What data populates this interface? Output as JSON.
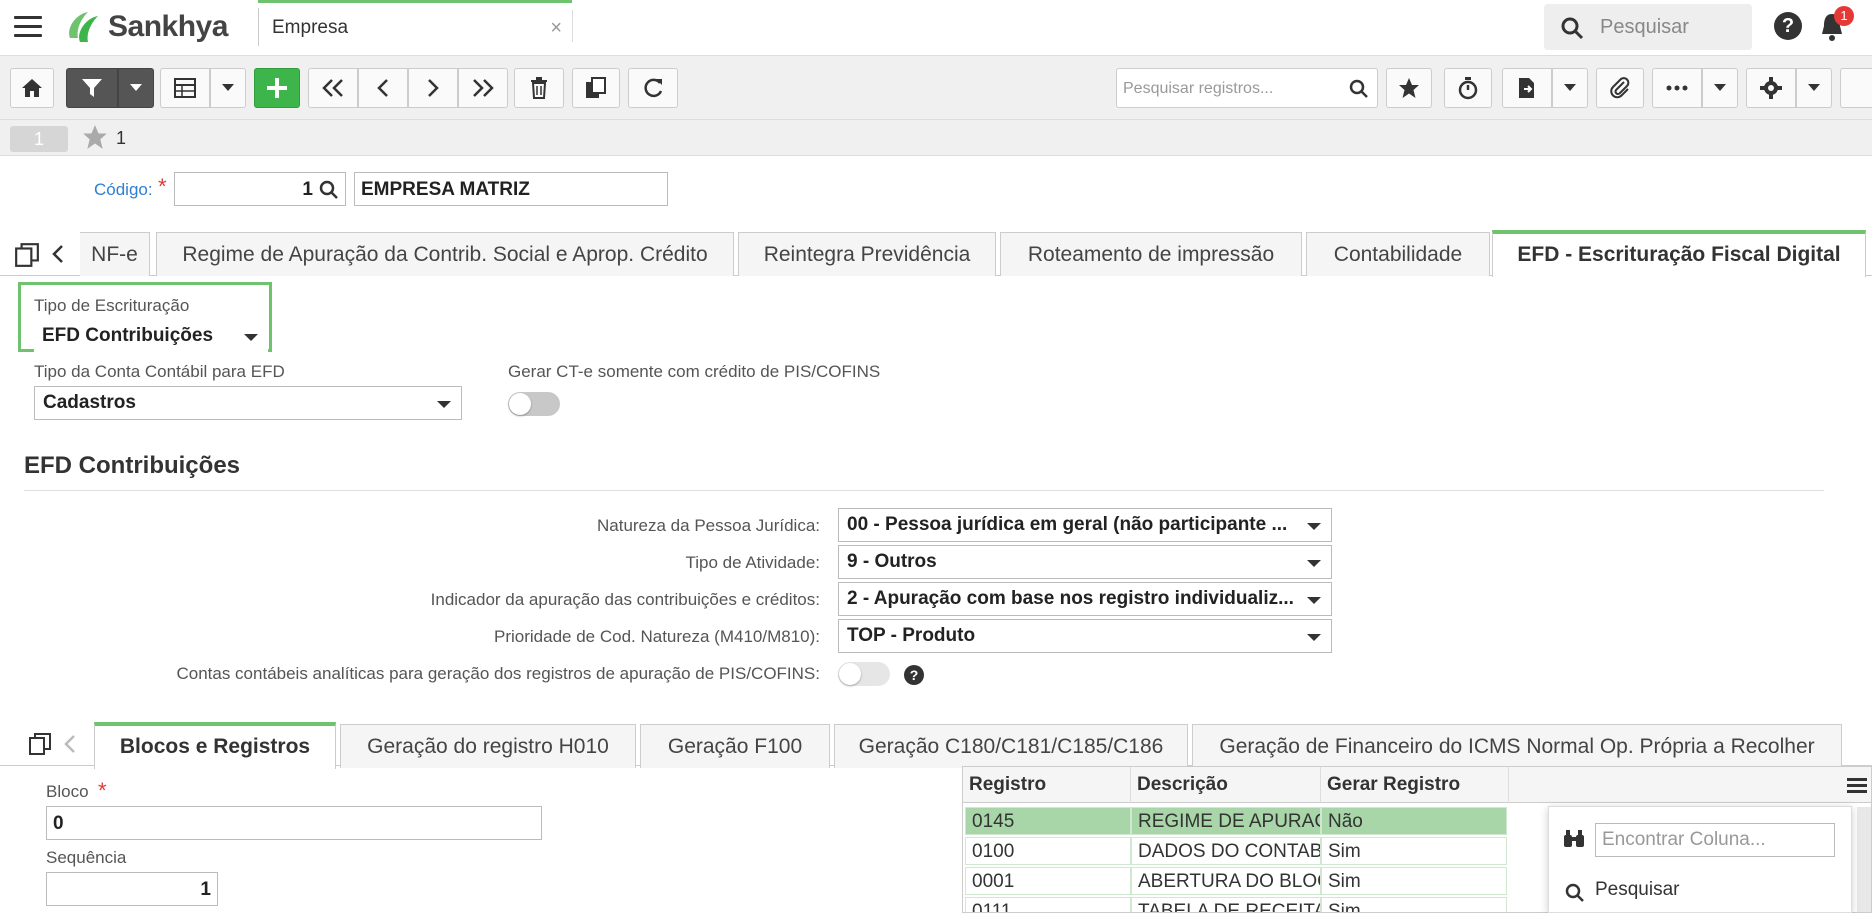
{
  "header": {
    "brand": "Sankhya",
    "app_tab_title": "Empresa",
    "close_glyph": "×",
    "search_placeholder": "Pesquisar",
    "help_glyph": "?",
    "notification_count": "1"
  },
  "toolbar": {
    "record_search_placeholder": "Pesquisar registros..."
  },
  "record_nav": {
    "page_pill": "1",
    "favorite_count": "1"
  },
  "codigo": {
    "label": "Código:",
    "required_mark": "*",
    "value": "1",
    "description": "EMPRESA MATRIZ"
  },
  "tabs": [
    {
      "label": "NF-e"
    },
    {
      "label": "Regime de Apuração da Contrib. Social e Aprop. Crédito"
    },
    {
      "label": "Reintegra Previdência"
    },
    {
      "label": "Roteamento de impressão"
    },
    {
      "label": "Contabilidade"
    },
    {
      "label": "EFD - Escrituração Fiscal Digital",
      "active": true
    }
  ],
  "efd": {
    "tipo_escrituracao_label": "Tipo de Escrituração",
    "tipo_escrituracao_value": "EFD Contribuições",
    "tipo_conta_label": "Tipo da Conta Contábil para EFD",
    "tipo_conta_value": "Cadastros",
    "gerar_cte_label": "Gerar CT-e somente com crédito de PIS/COFINS",
    "section_title": "EFD Contribuições",
    "natureza_label": "Natureza da Pessoa Jurídica:",
    "natureza_value": "00 - Pessoa jurídica em geral (não participante ...",
    "atividade_label": "Tipo de Atividade:",
    "atividade_value": "9 - Outros",
    "indicador_label": "Indicador da apuração das contribuições e créditos:",
    "indicador_value": "2 - Apuração com base nos registro individualiz...",
    "prioridade_label": "Prioridade de Cod. Natureza (M410/M810):",
    "prioridade_value": "TOP - Produto",
    "contas_label": "Contas contábeis analíticas para geração dos registros de apuração de PIS/COFINS:",
    "contas_help": "?"
  },
  "subtabs": [
    {
      "label": "Blocos e Registros",
      "active": true
    },
    {
      "label": "Geração do registro H010"
    },
    {
      "label": "Geração F100"
    },
    {
      "label": "Geração C180/C181/C185/C186"
    },
    {
      "label": "Geração de Financeiro do ICMS Normal Op. Própria a Recolher"
    }
  ],
  "bloco": {
    "bloco_label": "Bloco",
    "required_mark": "*",
    "bloco_value": "0",
    "sequencia_label": "Sequência",
    "sequencia_value": "1"
  },
  "grid": {
    "headers": [
      "Registro",
      "Descrição",
      "Gerar Registro"
    ],
    "rows": [
      {
        "registro": "0145",
        "descricao": "REGIME DE APURAÇÃO",
        "gerar": "Não",
        "selected": true
      },
      {
        "registro": "0100",
        "descricao": "DADOS DO CONTABILISTA",
        "gerar": "Sim"
      },
      {
        "registro": "0001",
        "descricao": "ABERTURA DO BLOCO",
        "gerar": "Sim"
      },
      {
        "registro": "0111",
        "descricao": "TABELA DE RECEITA",
        "gerar": "Sim"
      }
    ]
  },
  "column_popup": {
    "find_placeholder": "Encontrar Coluna...",
    "search_label": "Pesquisar"
  }
}
